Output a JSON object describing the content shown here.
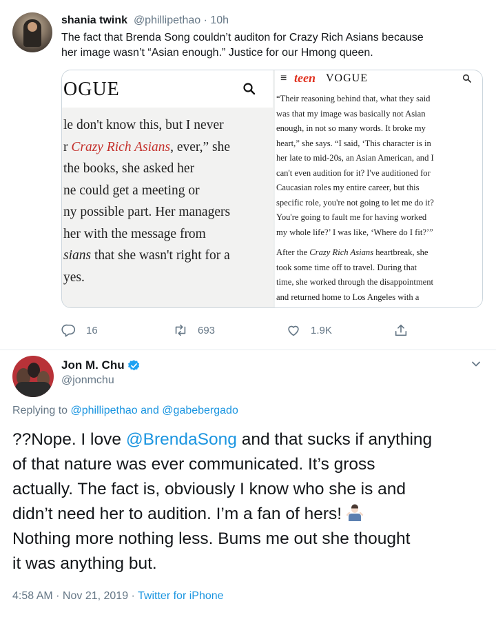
{
  "tweet1": {
    "display_name": "shania twink",
    "handle": "@phillipethao",
    "sep": " · ",
    "time": "10h",
    "text_line1": "The fact that Brenda Song couldn’t auditon for Crazy Rich Asians because",
    "text_line2": "her image wasn’t “Asian enough.” Justice for our Hmong queen.",
    "image_left": {
      "logo": "OGUE",
      "lines": [
        "le don't know this, but I never",
        "r ",
        "Crazy Rich Asians",
        ", ever,” she",
        "the books, she asked her",
        "ne could get a meeting or",
        "ny possible part. Her managers",
        "her with the message from",
        "sians",
        " that she wasn't right for a",
        "yes."
      ]
    },
    "image_right": {
      "menu": "≡",
      "logo_teen": "teen",
      "logo_vogue": "VOGUE",
      "lines": [
        "“Their reasoning behind that, what they said",
        "was that my image was basically not Asian",
        "enough, in not so many words. It broke my",
        "heart,” she says. “I said, ‘This character is in",
        "her late to mid-20s, an Asian American, and I",
        "can't even audition for it? I've auditioned for",
        "Caucasian roles my entire career, but this",
        "specific role, you're not going to let me do it?",
        "You're going to fault me for having worked",
        "my whole life?’ I was like, ‘Where do I fit?’”",
        "After the ",
        "Crazy Rich Asians",
        " heartbreak, she",
        "took some time off to travel. During that",
        "time, she worked through the disappointment",
        "and returned home to Los Angeles with a"
      ]
    },
    "actions": {
      "replies": "16",
      "retweets": "693",
      "likes": "1.9K"
    }
  },
  "tweet2": {
    "display_name": "Jon M. Chu",
    "handle": "@jonmchu",
    "replying_prefix": "Replying to ",
    "replying_user1": "@phillipethao",
    "replying_and": " and ",
    "replying_user2": "@gabebergado",
    "lines": [
      "??Nope. I love ",
      "@BrendaSong",
      " and that sucks if anything",
      "of that nature was ever communicated. It’s gross",
      "actually. The fact is, obviously I know who she is and",
      "didn’t need her to audition. I’m a fan of hers!",
      "Nothing more nothing less.  Bums me out she thought",
      "it was anything but."
    ],
    "timestamp": "4:58 AM · Nov 21, 2019 · ",
    "source": "Twitter for iPhone"
  },
  "colors": {
    "accent": "#1b95e0",
    "secondary_text": "#657786",
    "verified": "#1da1f2",
    "teen_vogue_red": "#e0301e"
  },
  "icons": [
    "reply-icon",
    "retweet-icon",
    "like-icon",
    "share-icon",
    "verified-badge-icon",
    "chevron-down-icon",
    "search-icon",
    "menu-icon",
    "shrug-emoji-icon"
  ]
}
